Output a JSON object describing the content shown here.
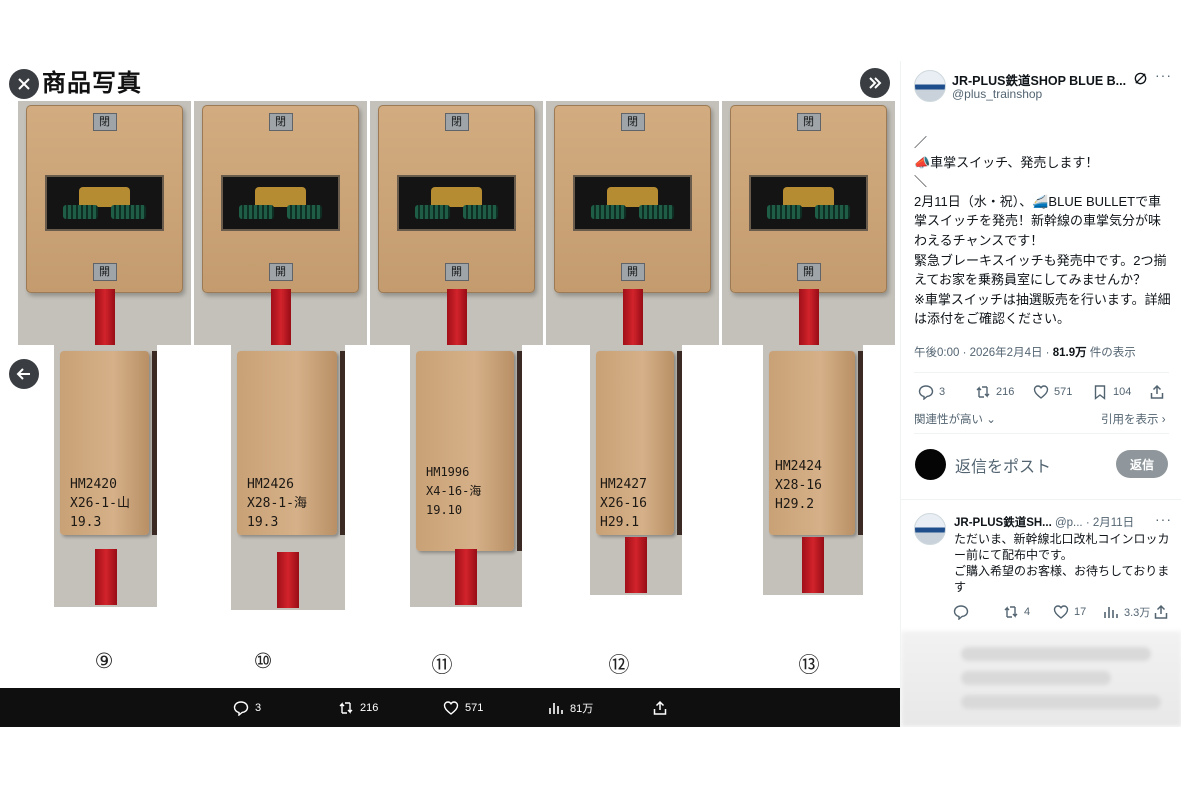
{
  "viewer": {
    "title": "商品写真",
    "close_icon": "close-icon",
    "collapse_icon": "double-chevron-right-icon",
    "prev_icon": "arrow-left-icon",
    "top_plates": {
      "top": "閉",
      "bottom": "開"
    },
    "units": [
      {
        "label": "HM2420\nX26-1-山\n19.3",
        "number": "⑨"
      },
      {
        "label": "HM2426\nX28-1-海\n19.3",
        "number": "⑩"
      },
      {
        "label": "HM1996\nX4-16-海\n19.10",
        "number": "⑪"
      },
      {
        "label": "HM2427\nX26-16\nH29.1",
        "number": "⑫"
      },
      {
        "label": "HM2424\nX28-16\nH29.2",
        "number": "⑬"
      }
    ],
    "bar": {
      "replies": "3",
      "reposts": "216",
      "likes": "571",
      "views": "81万"
    }
  },
  "post": {
    "author_name": "JR-PLUS鉄道SHOP BLUE B...",
    "author_handle": "@plus_trainshop",
    "text": "／\n📣車掌スイッチ、発売します！\n＼\n2月11日（水・祝）、🚄BLUE BULLETで車掌スイッチを発売！新幹線の車掌気分が味わえるチャンスです！\n緊急ブレーキスイッチも発売中です。2つ揃えてお家を乗務員室にしてみませんか？\n※車掌スイッチは抽選販売を行います。詳細は添付をご確認ください。",
    "time": "午後0:00 · 2026年2月4日 · ",
    "views_count": "81.9万",
    "views_label": " 件の表示",
    "actions": {
      "replies": "3",
      "reposts": "216",
      "likes": "571",
      "bookmarks": "104"
    },
    "sort_label": "関連性が高い",
    "quotes_label": "引用を表示 ›",
    "reply_placeholder": "返信をポスト",
    "reply_button": "返信"
  },
  "reply": {
    "author_name": "JR-PLUS鉄道SH...",
    "author_handle": "@p...",
    "date": "· 2月11日",
    "text": "ただいま、新幹線北口改札コインロッカー前にて配布中です。\nご購入希望のお客様、お待ちしております",
    "actions": {
      "replies": "",
      "reposts": "4",
      "likes": "17",
      "views": "3.3万"
    }
  },
  "colors": {
    "accent": "#1d9bf0",
    "text": "#0f1419",
    "muted": "#536471",
    "handle_red": "#d2232b",
    "box_tan": "#d2ac80"
  }
}
